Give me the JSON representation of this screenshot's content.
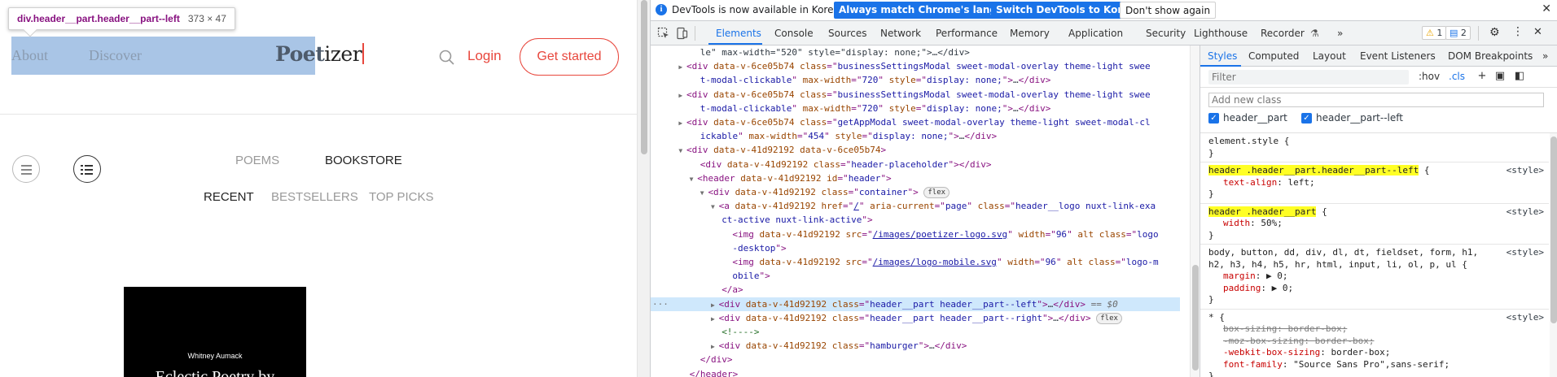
{
  "site": {
    "tooltip": {
      "name": "div.header__part.header__part--left",
      "size": "373 × 47"
    },
    "nav": {
      "about": "About",
      "discover": "Discover"
    },
    "logo": {
      "text_a": "Poet",
      "text_b": "izer"
    },
    "login": "Login",
    "get_started": "Get started",
    "tabs": {
      "poems": "POEMS",
      "bookstore": "BOOKSTORE"
    },
    "subtabs": {
      "recent": "RECENT",
      "bestsellers": "BESTSELLERS",
      "top_picks": "TOP PICKS"
    },
    "book": {
      "author": "Whitney Aumack",
      "title": "Eclectic Poetry by"
    },
    "colors": {
      "accent": "#e8473d",
      "highlight": "#a9c5e6"
    }
  },
  "devtools": {
    "infobar": {
      "text": "DevTools is now available in Korean!",
      "btn_match": "Always match Chrome's language",
      "btn_switch": "Switch DevTools to Korean",
      "btn_dont": "Don't show again"
    },
    "tabs": [
      "Elements",
      "Console",
      "Sources",
      "Network",
      "Performance",
      "Memory",
      "Application",
      "Security",
      "Lighthouse",
      "Recorder"
    ],
    "more_tabs": "»",
    "warnings_count": "1",
    "messages_count": "2",
    "elements": {
      "lines": [
        {
          "indent": 8,
          "tri": "",
          "parts": [
            [
              "txt",
              "le\" max-width=\"520\" style=\"display: none;\">…</div>"
            ]
          ]
        },
        {
          "indent": 4,
          "tri": "▶",
          "parts": [
            [
              "tg",
              "<div "
            ],
            [
              "an",
              "data-v-6ce05b74 class"
            ],
            [
              "tg",
              "=\""
            ],
            [
              "av",
              "businessSettingsModal sweet-modal-overlay theme-light swee"
            ]
          ]
        },
        {
          "indent": 8,
          "tri": "",
          "parts": [
            [
              "av",
              "t-modal-clickable"
            ],
            [
              "tg",
              "\" "
            ],
            [
              "an",
              "max-width"
            ],
            [
              "tg",
              "=\""
            ],
            [
              "av",
              "720"
            ],
            [
              "tg",
              "\" "
            ],
            [
              "an",
              "style"
            ],
            [
              "tg",
              "=\""
            ],
            [
              "av",
              "display: none;"
            ],
            [
              "tg",
              "\">"
            ],
            [
              "txt",
              "…"
            ],
            [
              "tg",
              "</div>"
            ]
          ]
        },
        {
          "indent": 4,
          "tri": "▶",
          "parts": [
            [
              "tg",
              "<div "
            ],
            [
              "an",
              "data-v-6ce05b74 class"
            ],
            [
              "tg",
              "=\""
            ],
            [
              "av",
              "businessSettingsModal sweet-modal-overlay theme-light swee"
            ]
          ]
        },
        {
          "indent": 8,
          "tri": "",
          "parts": [
            [
              "av",
              "t-modal-clickable"
            ],
            [
              "tg",
              "\" "
            ],
            [
              "an",
              "max-width"
            ],
            [
              "tg",
              "=\""
            ],
            [
              "av",
              "720"
            ],
            [
              "tg",
              "\" "
            ],
            [
              "an",
              "style"
            ],
            [
              "tg",
              "=\""
            ],
            [
              "av",
              "display: none;"
            ],
            [
              "tg",
              "\">"
            ],
            [
              "txt",
              "…"
            ],
            [
              "tg",
              "</div>"
            ]
          ]
        },
        {
          "indent": 4,
          "tri": "▶",
          "parts": [
            [
              "tg",
              "<div "
            ],
            [
              "an",
              "data-v-6ce05b74 class"
            ],
            [
              "tg",
              "=\""
            ],
            [
              "av",
              "getAppModal sweet-modal-overlay theme-light sweet-modal-cl"
            ]
          ]
        },
        {
          "indent": 8,
          "tri": "",
          "parts": [
            [
              "av",
              "ickable"
            ],
            [
              "tg",
              "\" "
            ],
            [
              "an",
              "max-width"
            ],
            [
              "tg",
              "=\""
            ],
            [
              "av",
              "454"
            ],
            [
              "tg",
              "\" "
            ],
            [
              "an",
              "style"
            ],
            [
              "tg",
              "=\""
            ],
            [
              "av",
              "display: none;"
            ],
            [
              "tg",
              "\">"
            ],
            [
              "txt",
              "…"
            ],
            [
              "tg",
              "</div>"
            ]
          ]
        },
        {
          "indent": 4,
          "tri": "▼",
          "parts": [
            [
              "tg",
              "<div "
            ],
            [
              "an",
              "data-v-41d92192 data-v-6ce05b74"
            ],
            [
              "tg",
              ">"
            ]
          ]
        },
        {
          "indent": 8,
          "tri": "",
          "parts": [
            [
              "tg",
              "<div "
            ],
            [
              "an",
              "data-v-41d92192 class"
            ],
            [
              "tg",
              "=\""
            ],
            [
              "av",
              "header-placeholder"
            ],
            [
              "tg",
              "\"></div>"
            ]
          ]
        },
        {
          "indent": 6,
          "tri": "▼",
          "parts": [
            [
              "tg",
              "<header "
            ],
            [
              "an",
              "data-v-41d92192 id"
            ],
            [
              "tg",
              "=\""
            ],
            [
              "av",
              "header"
            ],
            [
              "tg",
              "\">"
            ]
          ]
        },
        {
          "indent": 8,
          "tri": "▼",
          "parts": [
            [
              "tg",
              "<div "
            ],
            [
              "an",
              "data-v-41d92192 class"
            ],
            [
              "tg",
              "=\""
            ],
            [
              "av",
              "container"
            ],
            [
              "tg",
              "\">"
            ],
            [
              "txt",
              " "
            ],
            [
              "pill",
              "flex"
            ]
          ]
        },
        {
          "indent": 10,
          "tri": "▼",
          "parts": [
            [
              "tg",
              "<a "
            ],
            [
              "an",
              "data-v-41d92192 href"
            ],
            [
              "tg",
              "=\""
            ],
            [
              "lk",
              "/"
            ],
            [
              "tg",
              "\" "
            ],
            [
              "an",
              "aria-current"
            ],
            [
              "tg",
              "=\""
            ],
            [
              "av",
              "page"
            ],
            [
              "tg",
              "\" "
            ],
            [
              "an",
              "class"
            ],
            [
              "tg",
              "=\""
            ],
            [
              "av",
              "header__logo nuxt-link-exa"
            ]
          ]
        },
        {
          "indent": 12,
          "tri": "",
          "parts": [
            [
              "av",
              "ct-active nuxt-link-active"
            ],
            [
              "tg",
              "\">"
            ]
          ]
        },
        {
          "indent": 14,
          "tri": "",
          "parts": [
            [
              "tg",
              "<img "
            ],
            [
              "an",
              "data-v-41d92192 src"
            ],
            [
              "tg",
              "=\""
            ],
            [
              "lk",
              "/images/poetizer-logo.svg"
            ],
            [
              "tg",
              "\" "
            ],
            [
              "an",
              "width"
            ],
            [
              "tg",
              "=\""
            ],
            [
              "av",
              "96"
            ],
            [
              "tg",
              "\" "
            ],
            [
              "an",
              "alt class"
            ],
            [
              "tg",
              "=\""
            ],
            [
              "av",
              "logo"
            ]
          ]
        },
        {
          "indent": 14,
          "tri": "",
          "parts": [
            [
              "av",
              "-desktop"
            ],
            [
              "tg",
              "\">"
            ]
          ]
        },
        {
          "indent": 14,
          "tri": "",
          "parts": [
            [
              "tg",
              "<img "
            ],
            [
              "an",
              "data-v-41d92192 src"
            ],
            [
              "tg",
              "=\""
            ],
            [
              "lk",
              "/images/logo-mobile.svg"
            ],
            [
              "tg",
              "\" "
            ],
            [
              "an",
              "width"
            ],
            [
              "tg",
              "=\""
            ],
            [
              "av",
              "96"
            ],
            [
              "tg",
              "\" "
            ],
            [
              "an",
              "alt class"
            ],
            [
              "tg",
              "=\""
            ],
            [
              "av",
              "logo-m"
            ]
          ]
        },
        {
          "indent": 14,
          "tri": "",
          "parts": [
            [
              "av",
              "obile"
            ],
            [
              "tg",
              "\">"
            ]
          ]
        },
        {
          "indent": 12,
          "tri": "",
          "parts": [
            [
              "tg",
              "</a>"
            ]
          ]
        },
        {
          "indent": 10,
          "tri": "▶",
          "selected": true,
          "parts": [
            [
              "tg",
              "<div "
            ],
            [
              "an",
              "data-v-41d92192 class"
            ],
            [
              "tg",
              "=\""
            ],
            [
              "av",
              "header__part header__part--left"
            ],
            [
              "tg",
              "\">"
            ],
            [
              "txt",
              "…"
            ],
            [
              "tg",
              "</div>"
            ],
            [
              "eqs",
              " == $0"
            ]
          ]
        },
        {
          "indent": 10,
          "tri": "▶",
          "parts": [
            [
              "tg",
              "<div "
            ],
            [
              "an",
              "data-v-41d92192 class"
            ],
            [
              "tg",
              "=\""
            ],
            [
              "av",
              "header__part header__part--right"
            ],
            [
              "tg",
              "\">"
            ],
            [
              "txt",
              "…"
            ],
            [
              "tg",
              "</div>"
            ],
            [
              "txt",
              " "
            ],
            [
              "pill",
              "flex"
            ]
          ]
        },
        {
          "indent": 12,
          "tri": "",
          "parts": [
            [
              "cmt",
              "<!---->"
            ]
          ]
        },
        {
          "indent": 10,
          "tri": "▶",
          "parts": [
            [
              "tg",
              "<div "
            ],
            [
              "an",
              "data-v-41d92192 class"
            ],
            [
              "tg",
              "=\""
            ],
            [
              "av",
              "hamburger"
            ],
            [
              "tg",
              "\">"
            ],
            [
              "txt",
              "…"
            ],
            [
              "tg",
              "</div>"
            ]
          ]
        },
        {
          "indent": 8,
          "tri": "",
          "parts": [
            [
              "tg",
              "</div>"
            ]
          ]
        },
        {
          "indent": 6,
          "tri": "",
          "parts": [
            [
              "tg",
              "</header>"
            ]
          ]
        }
      ]
    },
    "styles": {
      "tabs": [
        "Styles",
        "Computed",
        "Layout",
        "Event Listeners",
        "DOM Breakpoints"
      ],
      "more_tabs": "»",
      "filter_placeholder": "Filter",
      "hov": ":hov",
      "cls": ".cls",
      "add_class_placeholder": "Add new class",
      "class_chips": [
        "header__part",
        "header__part--left"
      ],
      "rules": [
        {
          "selector": "element.style {",
          "highlight": false,
          "source": "",
          "props": [],
          "close": "}"
        },
        {
          "selector": "header .header__part.header__part--left",
          "highlight": true,
          "selector_tail": " {",
          "source": "<style>",
          "props": [
            {
              "name": "text-align",
              "value": "left;",
              "strike": false
            }
          ],
          "close": "}"
        },
        {
          "selector": "header .header__part",
          "highlight": true,
          "selector_tail": " {",
          "source": "<style>",
          "props": [
            {
              "name": "width",
              "value": "50%;",
              "strike": false
            }
          ],
          "close": "}"
        },
        {
          "selector": "body, button, dd, div, dl, dt, fieldset, form, h1,",
          "selector2": "h2, h3, h4, h5, hr, html, input, li, ol, p, ul {",
          "highlight": false,
          "source": "<style>",
          "props": [
            {
              "name": "margin",
              "value": "▶ 0;",
              "strike": false
            },
            {
              "name": "padding",
              "value": "▶ 0;",
              "strike": false
            }
          ],
          "close": "}"
        },
        {
          "selector": "* {",
          "highlight": false,
          "source": "<style>",
          "props": [
            {
              "name": "box-sizing",
              "value": "border-box;",
              "strike": true
            },
            {
              "name": "-moz-box-sizing",
              "value": "border-box;",
              "strike": true
            },
            {
              "name": "-webkit-box-sizing",
              "value": "border-box;",
              "strike": false
            },
            {
              "name": "font-family",
              "value": "\"Source Sans Pro\",sans-serif;",
              "strike": false
            }
          ],
          "close": "}"
        }
      ]
    }
  }
}
